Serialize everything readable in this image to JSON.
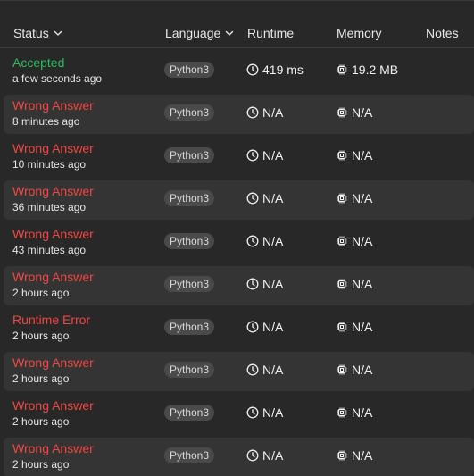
{
  "header": {
    "status": "Status",
    "language": "Language",
    "runtime": "Runtime",
    "memory": "Memory",
    "notes": "Notes"
  },
  "rows": [
    {
      "status": "Accepted",
      "kind": "ok",
      "time": "a few seconds ago",
      "language": "Python3",
      "runtime": "419 ms",
      "memory": "19.2 MB"
    },
    {
      "status": "Wrong Answer",
      "kind": "err",
      "time": "8 minutes ago",
      "language": "Python3",
      "runtime": "N/A",
      "memory": "N/A"
    },
    {
      "status": "Wrong Answer",
      "kind": "err",
      "time": "10 minutes ago",
      "language": "Python3",
      "runtime": "N/A",
      "memory": "N/A"
    },
    {
      "status": "Wrong Answer",
      "kind": "err",
      "time": "36 minutes ago",
      "language": "Python3",
      "runtime": "N/A",
      "memory": "N/A"
    },
    {
      "status": "Wrong Answer",
      "kind": "err",
      "time": "43 minutes ago",
      "language": "Python3",
      "runtime": "N/A",
      "memory": "N/A"
    },
    {
      "status": "Wrong Answer",
      "kind": "err",
      "time": "2 hours ago",
      "language": "Python3",
      "runtime": "N/A",
      "memory": "N/A"
    },
    {
      "status": "Runtime Error",
      "kind": "err",
      "time": "2 hours ago",
      "language": "Python3",
      "runtime": "N/A",
      "memory": "N/A"
    },
    {
      "status": "Wrong Answer",
      "kind": "err",
      "time": "2 hours ago",
      "language": "Python3",
      "runtime": "N/A",
      "memory": "N/A"
    },
    {
      "status": "Wrong Answer",
      "kind": "err",
      "time": "2 hours ago",
      "language": "Python3",
      "runtime": "N/A",
      "memory": "N/A"
    },
    {
      "status": "Wrong Answer",
      "kind": "err",
      "time": "2 hours ago",
      "language": "Python3",
      "runtime": "N/A",
      "memory": "N/A"
    }
  ],
  "icons": {
    "runtime": "clock-icon",
    "memory": "chip-icon",
    "sort": "chevron-down-icon"
  },
  "colors": {
    "accepted": "#2cbb5d",
    "error": "#ef4743",
    "background": "#282828",
    "row_alt": "#343434"
  }
}
